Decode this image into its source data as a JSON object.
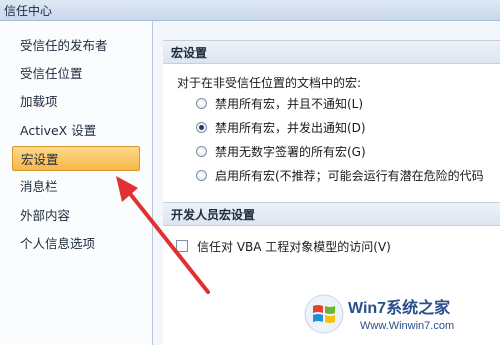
{
  "window": {
    "title": "信任中心"
  },
  "sidebar": {
    "items": [
      {
        "label": "受信任的发布者"
      },
      {
        "label": "受信任位置"
      },
      {
        "label": "加载项"
      },
      {
        "label": "ActiveX 设置"
      },
      {
        "label": "宏设置",
        "active": true
      },
      {
        "label": "消息栏"
      },
      {
        "label": "外部内容"
      },
      {
        "label": "个人信息选项"
      }
    ]
  },
  "macro_settings": {
    "header": "宏设置",
    "intro": "对于在非受信任位置的文档中的宏:",
    "options": [
      {
        "label": "禁用所有宏，并且不通知(L)",
        "checked": false
      },
      {
        "label": "禁用所有宏，并发出通知(D)",
        "checked": true
      },
      {
        "label": "禁用无数字签署的所有宏(G)",
        "checked": false
      },
      {
        "label": "启用所有宏(不推荐；可能会运行有潜在危险的代码",
        "checked": false
      }
    ]
  },
  "developer_settings": {
    "header": "开发人员宏设置",
    "checkbox_label": "信任对 VBA 工程对象模型的访问(V)",
    "checked": false
  },
  "watermark": {
    "title": "Win7系统之家",
    "url": "Www.Winwin7.com"
  },
  "colors": {
    "arrow": "#e03030",
    "active_nav": "#f7b64a"
  }
}
